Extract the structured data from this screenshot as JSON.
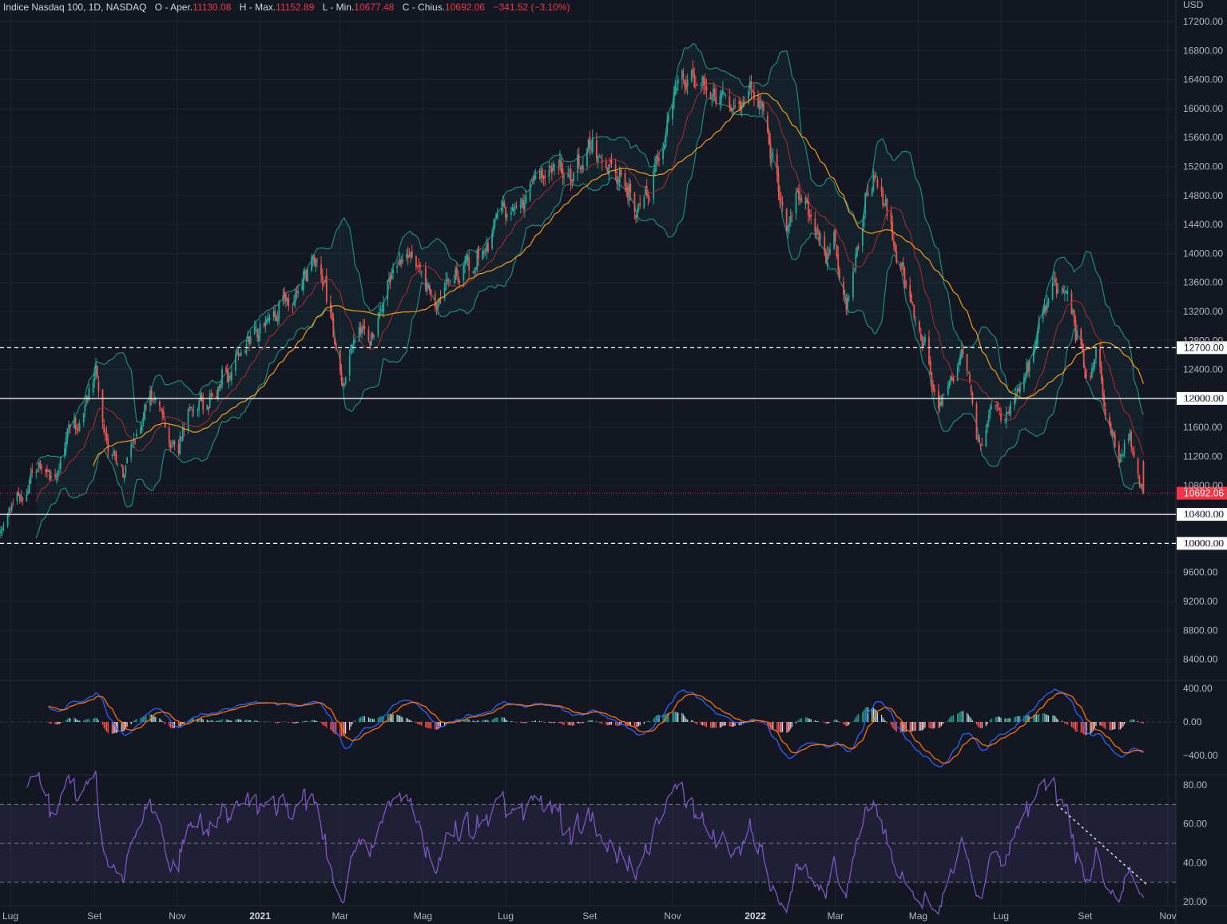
{
  "header": {
    "symbol": "Indice Nasdaq 100, 1D, NASDAQ",
    "open_label": "O - Aper.",
    "open": "11130.08",
    "high_label": "H - Max.",
    "high": "11152.89",
    "low_label": "L - Min.",
    "low": "10677.48",
    "close_label": "C - Chius.",
    "close": "10692.06",
    "change": "−341.52 (−3.10%)"
  },
  "colors": {
    "background": "#131722",
    "grid": "#1f2431",
    "up": "#26a69a",
    "down": "#ef5350",
    "bb_band": "#1e8a7a",
    "bb_fill": "rgba(38,166,154,0.07)",
    "bb_basis": "#b22833",
    "sma50": "#f29b1d",
    "macd": "#2962ff",
    "signal": "#ff6d00",
    "rsi": "#7e57c2",
    "rsi_band_fill": "rgba(126,87,194,0.12)",
    "last_price": "#f23645"
  },
  "chart_data": {
    "type": "candlestick",
    "title": "Indice Nasdaq 100, 1D, NASDAQ",
    "currency": "USD",
    "price_axis": {
      "ylim": [
        8200,
        17400
      ],
      "ticks": [
        "17200.00",
        "16800.00",
        "16400.00",
        "16000.00",
        "15600.00",
        "15200.00",
        "14800.00",
        "14400.00",
        "14000.00",
        "13600.00",
        "13200.00",
        "12800.00",
        "12400.00",
        "12000.00",
        "11600.00",
        "11200.00",
        "10800.00",
        "10400.00",
        "10000.00",
        "9600.00",
        "9200.00",
        "8800.00",
        "8400.00"
      ]
    },
    "time_axis": [
      {
        "date": "2020-07-01",
        "label": "Lug"
      },
      {
        "date": "2020-09-01",
        "label": "Set"
      },
      {
        "date": "2020-11-01",
        "label": "Nov"
      },
      {
        "date": "2021-01-01",
        "label": "2021",
        "bold": true
      },
      {
        "date": "2021-03-01",
        "label": "Mar"
      },
      {
        "date": "2021-05-01",
        "label": "Mag"
      },
      {
        "date": "2021-07-01",
        "label": "Lug"
      },
      {
        "date": "2021-09-01",
        "label": "Set"
      },
      {
        "date": "2021-11-01",
        "label": "Nov"
      },
      {
        "date": "2022-01-01",
        "label": "2022",
        "bold": true
      },
      {
        "date": "2022-03-01",
        "label": "Mar"
      },
      {
        "date": "2022-05-01",
        "label": "Mag"
      },
      {
        "date": "2022-07-01",
        "label": "Lug"
      },
      {
        "date": "2022-09-01",
        "label": "Set"
      },
      {
        "date": "2022-11-01",
        "label": "Nov"
      }
    ],
    "close_path": [
      [
        "2020-06-23",
        10150
      ],
      [
        "2020-07-05",
        10665
      ],
      [
        "2020-07-23",
        11000
      ],
      [
        "2020-08-09",
        11215
      ],
      [
        "2020-08-27",
        11990
      ],
      [
        "2020-09-02",
        12320
      ],
      [
        "2020-09-11",
        11215
      ],
      [
        "2020-09-22",
        10885
      ],
      [
        "2020-10-04",
        11490
      ],
      [
        "2020-10-13",
        12100
      ],
      [
        "2020-10-22",
        11660
      ],
      [
        "2020-11-01",
        11050
      ],
      [
        "2020-11-10",
        12040
      ],
      [
        "2020-11-23",
        11930
      ],
      [
        "2020-12-11",
        12430
      ],
      [
        "2021-01-03",
        12870
      ],
      [
        "2021-01-21",
        13365
      ],
      [
        "2021-02-02",
        13585
      ],
      [
        "2021-02-14",
        13700
      ],
      [
        "2021-02-25",
        12870
      ],
      [
        "2021-03-04",
        12320
      ],
      [
        "2021-03-15",
        13090
      ],
      [
        "2021-03-27",
        12760
      ],
      [
        "2021-04-07",
        13640
      ],
      [
        "2021-04-16",
        13970
      ],
      [
        "2021-04-28",
        13860
      ],
      [
        "2021-05-12",
        13090
      ],
      [
        "2021-05-25",
        13640
      ],
      [
        "2021-06-11",
        13970
      ],
      [
        "2021-06-29",
        14630
      ],
      [
        "2021-07-16",
        14910
      ],
      [
        "2021-08-03",
        15130
      ],
      [
        "2021-08-18",
        14910
      ],
      [
        "2021-09-01",
        15620
      ],
      [
        "2021-09-19",
        15180
      ],
      [
        "2021-10-04",
        14580
      ],
      [
        "2021-10-16",
        15070
      ],
      [
        "2021-10-27",
        15735
      ],
      [
        "2021-11-08",
        16395
      ],
      [
        "2021-11-17",
        16450
      ],
      [
        "2021-11-23",
        16615
      ],
      [
        "2021-12-02",
        16175
      ],
      [
        "2021-12-10",
        16285
      ],
      [
        "2021-12-19",
        15845
      ],
      [
        "2021-12-28",
        16505
      ],
      [
        "2022-01-06",
        16065
      ],
      [
        "2022-01-15",
        15290
      ],
      [
        "2022-01-24",
        14300
      ],
      [
        "2022-02-01",
        14960
      ],
      [
        "2022-02-10",
        14520
      ],
      [
        "2022-02-22",
        13860
      ],
      [
        "2022-02-28",
        14190
      ],
      [
        "2022-03-09",
        13200
      ],
      [
        "2022-03-17",
        14190
      ],
      [
        "2022-03-29",
        15070
      ],
      [
        "2022-04-07",
        14630
      ],
      [
        "2022-04-16",
        14080
      ],
      [
        "2022-04-25",
        13420
      ],
      [
        "2022-05-06",
        12760
      ],
      [
        "2022-05-15",
        11880
      ],
      [
        "2022-05-24",
        12100
      ],
      [
        "2022-06-02",
        12650
      ],
      [
        "2022-06-08",
        12320
      ],
      [
        "2022-06-15",
        11215
      ],
      [
        "2022-06-25",
        11930
      ],
      [
        "2022-07-03",
        11545
      ],
      [
        "2022-07-13",
        11990
      ],
      [
        "2022-07-25",
        12650
      ],
      [
        "2022-08-05",
        13365
      ],
      [
        "2022-08-14",
        13585
      ],
      [
        "2022-08-23",
        13090
      ],
      [
        "2022-09-01",
        12320
      ],
      [
        "2022-09-10",
        12540
      ],
      [
        "2022-09-19",
        11770
      ],
      [
        "2022-09-25",
        11215
      ],
      [
        "2022-10-04",
        11490
      ],
      [
        "2022-10-10",
        10940
      ],
      [
        "2022-10-14",
        10692.06
      ]
    ],
    "last_bar": {
      "open": 11130.08,
      "high": 11152.89,
      "low": 10677.48,
      "close": 10692.06
    },
    "last_price_label": "10692.06",
    "horizontal_levels": [
      {
        "price": 12700,
        "label": "12700.00",
        "style": "dashed"
      },
      {
        "price": 12000,
        "label": "12000.00",
        "style": "solid"
      },
      {
        "price": 10400,
        "label": "10400.00",
        "style": "solid"
      },
      {
        "price": 10000,
        "label": "10000.00",
        "style": "dashed"
      }
    ],
    "overlays": [
      "Bollinger Bands (20, 2)",
      "SMA 50"
    ],
    "macd": {
      "params": [
        12,
        26,
        9
      ],
      "ylim": [
        -560,
        560
      ],
      "ticks": [
        "400.00",
        "0.00",
        "−400.00"
      ],
      "tick_values": [
        400,
        0,
        -400
      ]
    },
    "rsi": {
      "period": 14,
      "ylim": [
        20,
        80
      ],
      "ticks": [
        "80.00",
        "60.00",
        "40.00",
        "20.00"
      ],
      "tick_values": [
        80,
        60,
        40,
        20
      ],
      "bands": [
        70,
        50,
        30
      ],
      "trendline": [
        [
          "2022-08-11",
          70
        ],
        [
          "2022-10-16",
          29
        ]
      ]
    }
  }
}
